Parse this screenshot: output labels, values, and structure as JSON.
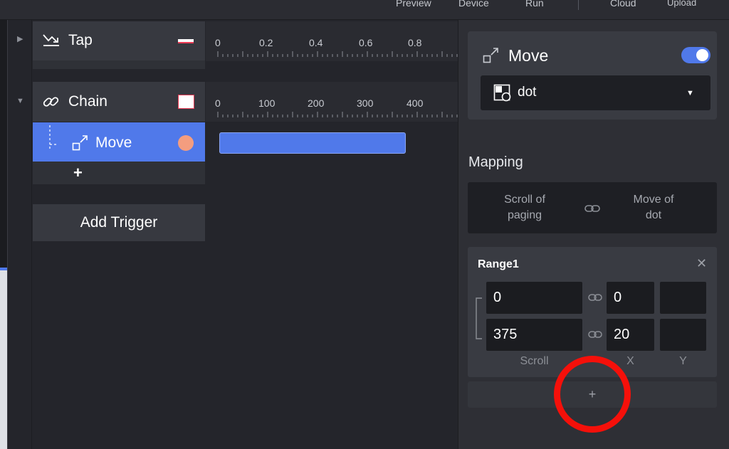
{
  "toolbar": {
    "preview": "Preview",
    "device": "Device",
    "run": "Run",
    "cloud": "Cloud",
    "upload": "Upload"
  },
  "triggers": {
    "tap": {
      "label": "Tap",
      "icon": "swipe-arrow-icon"
    },
    "chain": {
      "label": "Chain",
      "icon": "link-icon"
    },
    "move": {
      "label": "Move",
      "icon": "move-icon"
    },
    "add_step": "+",
    "add_trigger": "Add Trigger"
  },
  "timeline": {
    "tap_ticks": [
      "0",
      "0.2",
      "0.4",
      "0.6",
      "0.8"
    ],
    "chain_ticks": [
      "0",
      "100",
      "200",
      "300",
      "400"
    ]
  },
  "panel": {
    "title": "Move",
    "toggle_on": true,
    "target": "dot",
    "mapping_label": "Mapping",
    "mapping_from_line1": "Scroll of",
    "mapping_from_line2": "paging",
    "mapping_to_line1": "Move of",
    "mapping_to_line2": "dot",
    "range": {
      "title": "Range1",
      "rows": [
        {
          "scroll": "0",
          "x": "0",
          "y": ""
        },
        {
          "scroll": "375",
          "x": "20",
          "y": ""
        }
      ],
      "col_scroll": "Scroll",
      "col_x": "X",
      "col_y": "Y"
    },
    "add_range": "+"
  },
  "colors": {
    "accent": "#5079ea",
    "highlight": "#f5100a",
    "dot": "#f49d7f"
  }
}
